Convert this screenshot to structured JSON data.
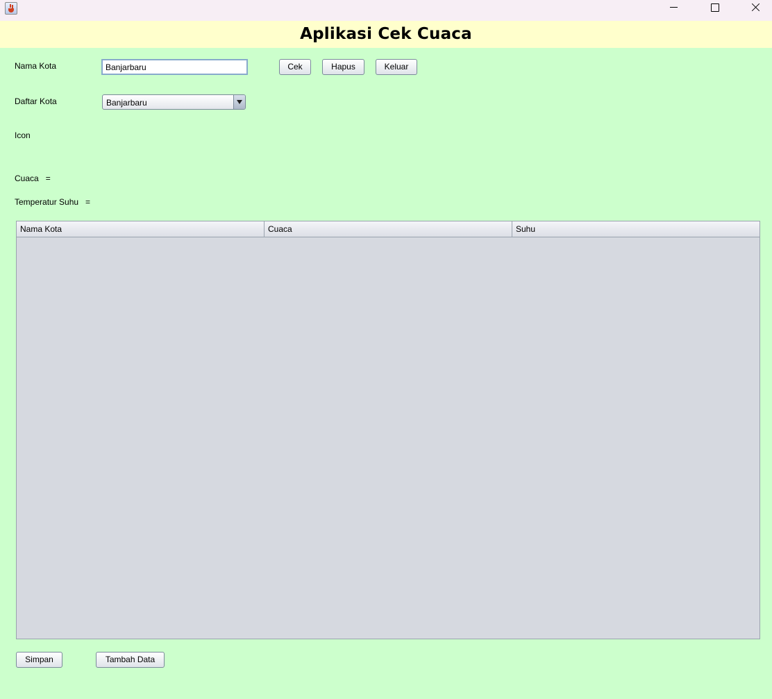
{
  "window": {
    "app_icon": "java-cup-icon",
    "controls": {
      "minimize": "minimize-icon",
      "maximize": "maximize-icon",
      "close": "close-icon"
    }
  },
  "header": {
    "title": "Aplikasi Cek Cuaca"
  },
  "form": {
    "nama_kota_label": "Nama Kota",
    "nama_kota_value": "Banjarbaru",
    "daftar_kota_label": "Daftar Kota",
    "daftar_kota_selected": "Banjarbaru",
    "icon_label": "Icon",
    "cuaca_label": "Cuaca   =",
    "suhu_label": "Temperatur Suhu   ="
  },
  "buttons": {
    "cek": "Cek",
    "hapus": "Hapus",
    "keluar": "Keluar",
    "simpan": "Simpan",
    "tambah_data": "Tambah Data"
  },
  "table": {
    "columns": [
      "Nama Kota",
      "Cuaca",
      "Suhu"
    ],
    "rows": []
  },
  "colors": {
    "background": "#ccffcc",
    "header_background": "#ffffcc",
    "table_background": "#d6d9e0"
  }
}
